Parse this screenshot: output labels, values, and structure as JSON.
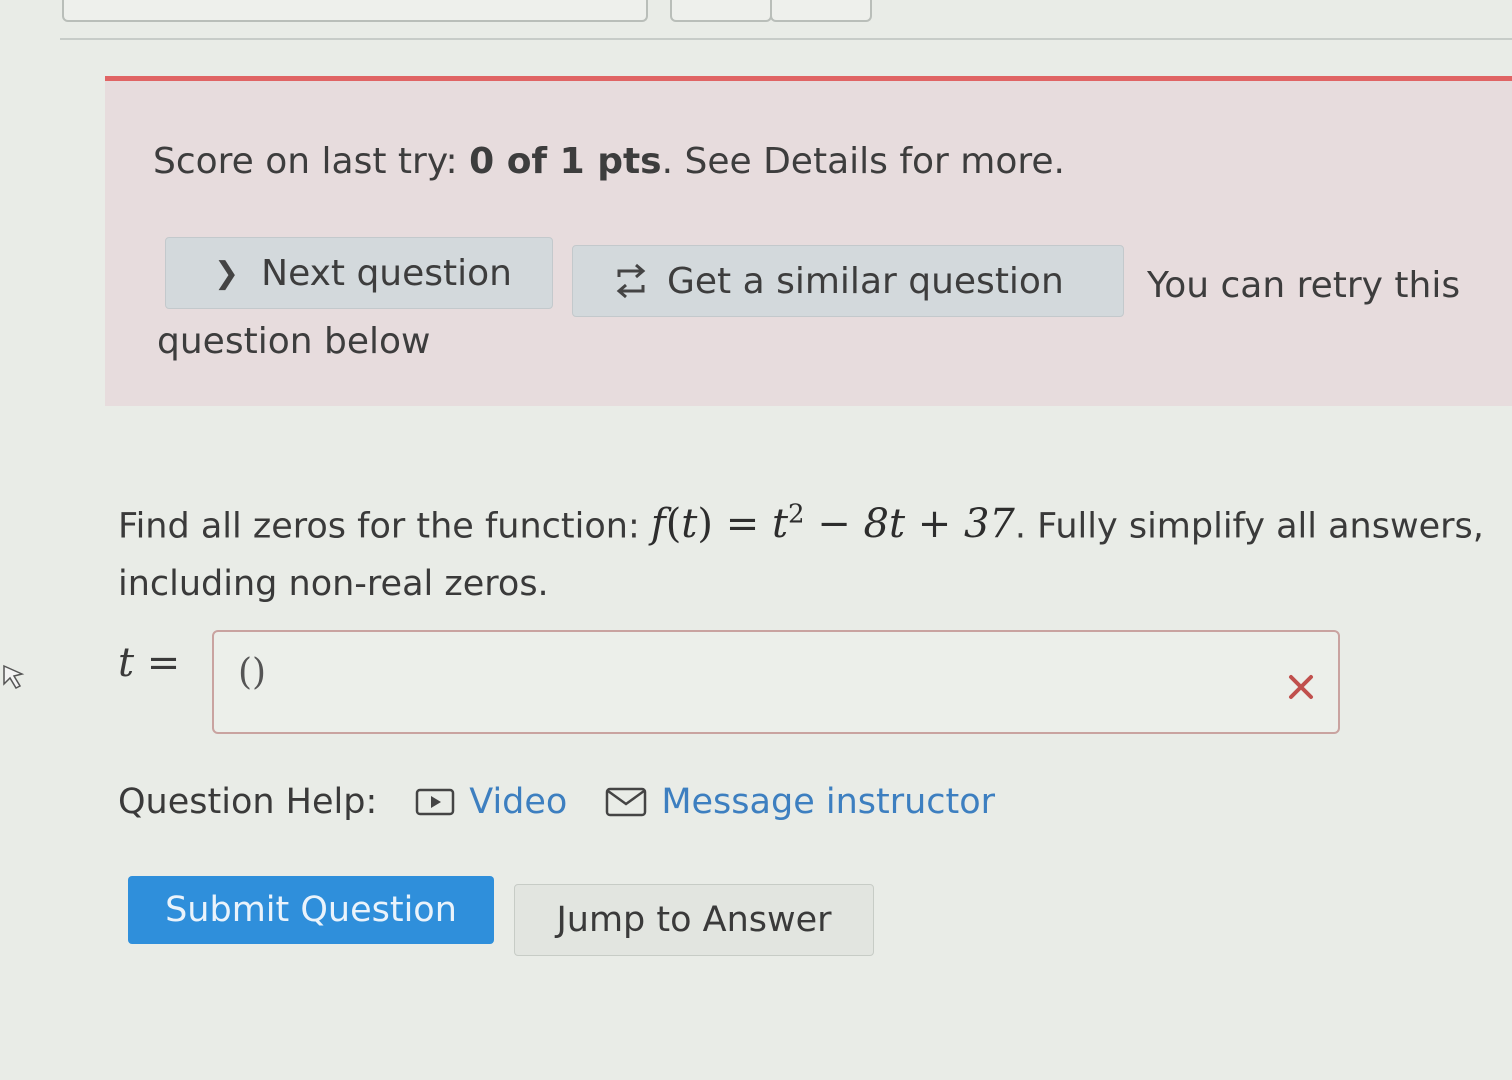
{
  "alert": {
    "score_prefix": "Score on last try: ",
    "score_value": "0 of 1 pts",
    "score_suffix": ". See Details for more.",
    "next_question_label": "Next question",
    "similar_question_label": "Get a similar question",
    "retry_text_part1": "You can retry this",
    "retry_text_part2": "question below"
  },
  "question": {
    "prompt_before": "Find all zeros for the function: ",
    "prompt_after": ". Fully simplify all answers, including non-real zeros.",
    "function_name": "f",
    "variable": "t",
    "expression_tail": "− 8t + 37"
  },
  "answer": {
    "label_var": "t",
    "label_eq": "=",
    "value": "()",
    "status": "incorrect"
  },
  "help": {
    "label": "Question Help:",
    "video_label": "Video",
    "message_label": "Message instructor"
  },
  "actions": {
    "submit_label": "Submit Question",
    "jump_label": "Jump to Answer"
  },
  "colors": {
    "alert_border": "#e06464",
    "alert_bg": "#e7dcdd",
    "link": "#3d7fc0",
    "submit_bg": "#2f8fdb",
    "error_x": "#c0504d"
  },
  "icons": {
    "next": "chevron-right-icon",
    "similar": "swap-arrows-icon",
    "video": "play-icon",
    "message": "envelope-icon",
    "invalid": "close-icon"
  }
}
